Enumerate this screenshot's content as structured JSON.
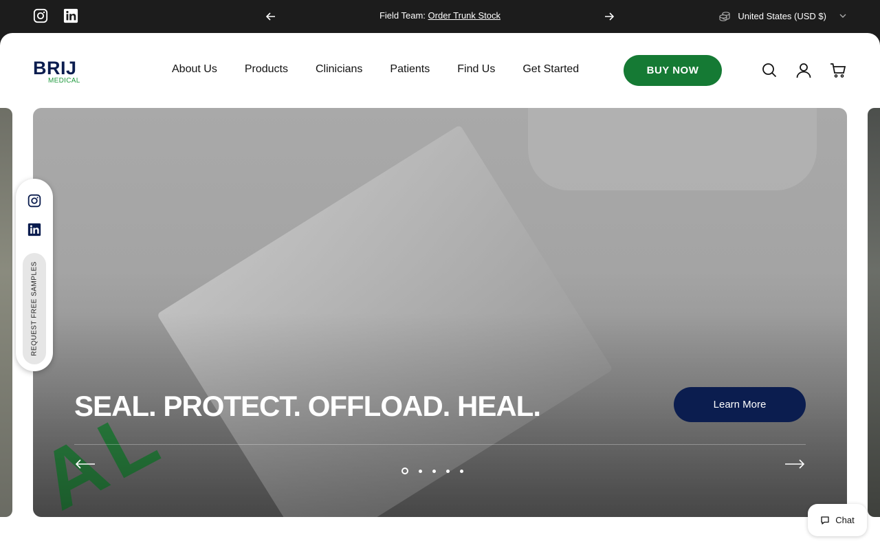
{
  "topbar": {
    "announcement_prefix": "Field Team:",
    "announcement_link": "Order Trunk Stock",
    "currency": "United States (USD $)"
  },
  "header": {
    "logo_main": "BRIJ",
    "logo_sub": "MEDICAL",
    "nav": [
      "About Us",
      "Products",
      "Clinicians",
      "Patients",
      "Find Us",
      "Get Started"
    ],
    "buy_button": "BUY NOW"
  },
  "hero": {
    "headline": "SEAL. PROTECT. OFFLOAD. HEAL.",
    "cta": "Learn More",
    "slide_count": 5,
    "active_slide": 1
  },
  "side_widget": {
    "samples_label": "REQUEST FREE SAMPLES"
  },
  "chat": {
    "label": "Chat"
  },
  "colors": {
    "accent_green": "#157a34",
    "navy": "#0b1d4f",
    "topbar_bg": "#1c1c1c"
  },
  "icons": [
    "instagram-icon",
    "linkedin-icon",
    "arrow-left-icon",
    "arrow-right-icon",
    "currency-icon",
    "chevron-down-icon",
    "search-icon",
    "account-icon",
    "cart-icon",
    "chat-icon"
  ]
}
